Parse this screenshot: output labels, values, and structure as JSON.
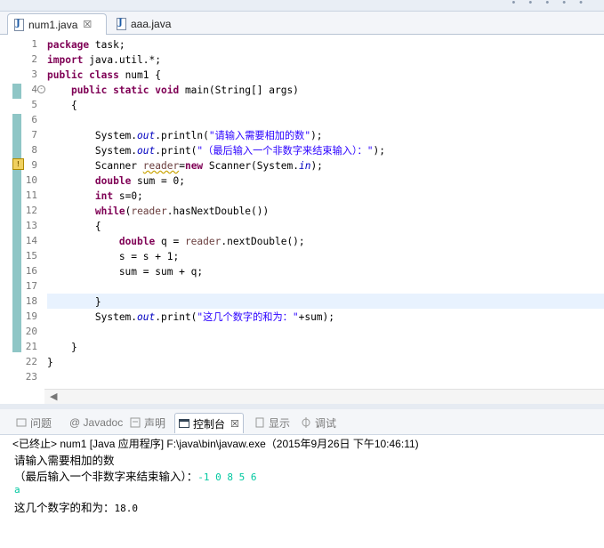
{
  "editor_tabs": [
    {
      "label": "num1.java",
      "close": "☒"
    },
    {
      "label": "aaa.java"
    }
  ],
  "line_numbers": [
    "1",
    "2",
    "3",
    "4",
    "5",
    "6",
    "7",
    "8",
    "9",
    "10",
    "11",
    "12",
    "13",
    "14",
    "15",
    "16",
    "17",
    "18",
    "19",
    "20",
    "21",
    "22",
    "23"
  ],
  "code": {
    "l1": {
      "kw": "package",
      "rest": " task;"
    },
    "l2": {
      "kw": "import",
      "rest": " java.util.*;"
    },
    "l3": {
      "kw": "public class",
      "rest": " num1 {"
    },
    "l4": {
      "indent": "    ",
      "kw": "public static void",
      "rest": " main(String[] args)"
    },
    "l5": {
      "text": "    {"
    },
    "l7": {
      "pre": "        System.",
      "field": "out",
      "mid": ".println(",
      "str": "\"请输入需要相加的数\"",
      "post": ");"
    },
    "l8": {
      "pre": "        System.",
      "field": "out",
      "mid": ".print(",
      "str": "\"（最后输入一个非数字来结束输入）：\"",
      "post": ");"
    },
    "l9": {
      "pre": "        Scanner ",
      "var": "reader",
      "mid": "=",
      "kw": "new",
      "post1": " Scanner(System.",
      "field": "in",
      "post2": ");"
    },
    "l10": {
      "pre": "        ",
      "kw": "double",
      "rest": " sum = 0;"
    },
    "l11": {
      "pre": "        ",
      "kw": "int",
      "rest": " s=0;"
    },
    "l12": {
      "pre": "        ",
      "kw": "while",
      "mid": "(",
      "var": "reader",
      "rest": ".hasNextDouble())"
    },
    "l13": {
      "text": "        {"
    },
    "l14": {
      "pre": "            ",
      "kw": "double",
      "mid": " q = ",
      "var": "reader",
      "rest": ".nextDouble();"
    },
    "l15": {
      "text": "            s = s + 1;"
    },
    "l16": {
      "text": "            sum = sum + q;"
    },
    "l18": {
      "text": "        }"
    },
    "l19": {
      "pre": "        System.",
      "field": "out",
      "mid": ".print(",
      "str": "\"这几个数字的和为：\"",
      "post": "+sum);"
    },
    "l21": {
      "text": "    }"
    },
    "l22": {
      "text": "}"
    }
  },
  "console_tabs": [
    {
      "label": "问题",
      "icon": "problems-icon"
    },
    {
      "label": "@ Javadoc",
      "icon": "javadoc-icon"
    },
    {
      "label": "声明",
      "icon": "declaration-icon"
    },
    {
      "label": "控制台",
      "icon": "console-icon",
      "close": "☒"
    },
    {
      "label": "显示",
      "icon": "display-icon"
    },
    {
      "label": "调试",
      "icon": "debug-icon"
    }
  ],
  "console": {
    "status": "<已终止> num1 [Java 应用程序] F:\\java\\bin\\javaw.exe（2015年9月26日 下午10:46:11)",
    "line1": "请输入需要相加的数",
    "line2_prompt": "（最后输入一个非数字来结束输入）：",
    "line2_input": "-1 0 8 5 6",
    "line3_input": "a",
    "line4_label": "这几个数字的和为：",
    "line4_value": "18.0"
  },
  "colors": {
    "keyword": "#7f0055",
    "string": "#2a00ff",
    "field": "#0000c0",
    "user_input": "#00c8a0",
    "current_line": "#e8f2fe"
  }
}
